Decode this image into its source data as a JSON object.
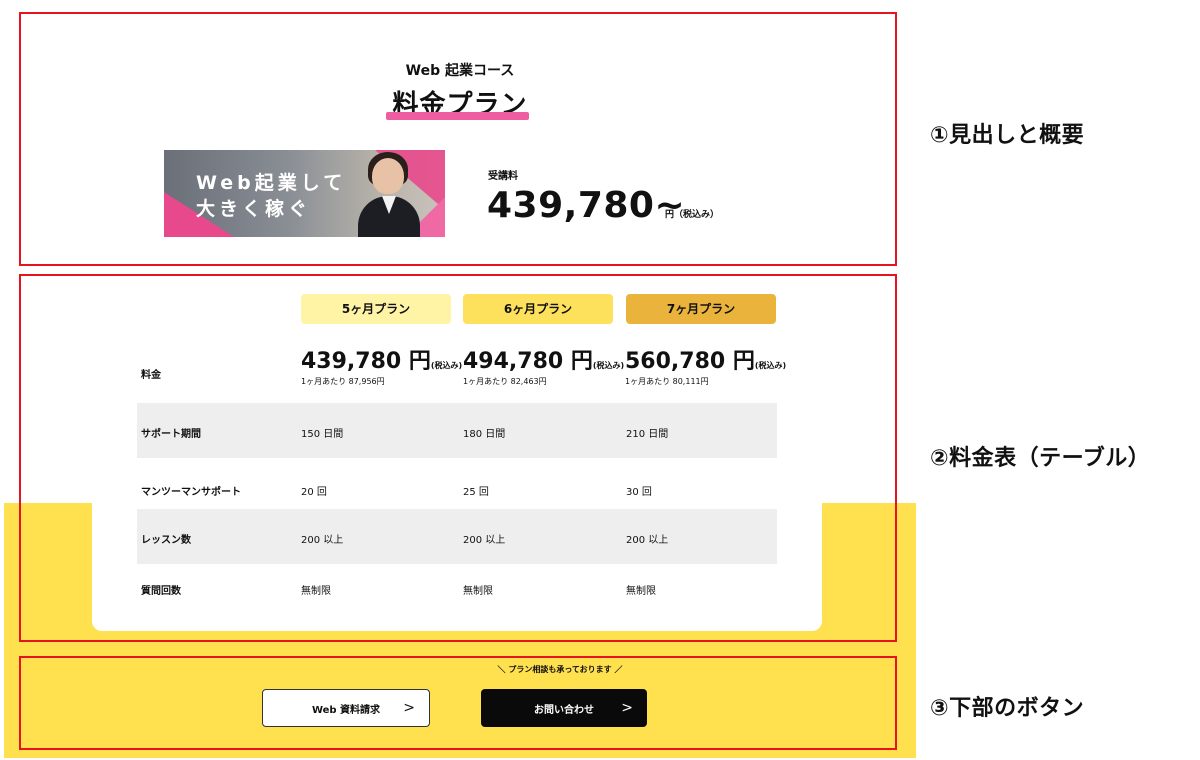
{
  "annotations": {
    "a1": "①見出しと概要",
    "a2": "②料金表（テーブル）",
    "a3": "③下部のボタン"
  },
  "header": {
    "subtitle": "Web 起業コース",
    "title": "料金プラン"
  },
  "banner": {
    "line1": "Web起業して",
    "line2": "大きく稼ぐ"
  },
  "fee": {
    "label": "受講料",
    "amount": "439,780~",
    "unit": "円（税込み）"
  },
  "plans": [
    {
      "name": "5ヶ月プラン",
      "price": "439,780",
      "yen": "円",
      "tax": "(税込み)",
      "monthly": "1ヶ月あたり 87,956円",
      "support": "150 日間",
      "mentoring": "20 回",
      "lessons": "200 以上",
      "questions": "無制限"
    },
    {
      "name": "6ヶ月プラン",
      "price": "494,780",
      "yen": "円",
      "tax": "(税込み)",
      "monthly": "1ヶ月あたり 82,463円",
      "support": "180 日間",
      "mentoring": "25 回",
      "lessons": "200 以上",
      "questions": "無制限"
    },
    {
      "name": "7ヶ月プラン",
      "price": "560,780",
      "yen": "円",
      "tax": "(税込み)",
      "monthly": "1ヶ月あたり 80,111円",
      "support": "210 日間",
      "mentoring": "30 回",
      "lessons": "200 以上",
      "questions": "無制限"
    }
  ],
  "rows": {
    "price": "料金",
    "support": "サポート期間",
    "mentoring": "マンツーマンサポート",
    "lessons": "レッスン数",
    "questions": "質問回数"
  },
  "footer": {
    "note": "＼ プラン相談も承っております ／",
    "docs_button": "Web 資料請求",
    "contact_button": "お問い合わせ",
    "arrow": ">"
  },
  "colors": {
    "yellow": "#ffe14f",
    "pink": "#f05ca0",
    "red_outline": "#e5141f",
    "plan5": "#fff3a6",
    "plan6": "#fde15c",
    "plan7": "#eab33c"
  }
}
